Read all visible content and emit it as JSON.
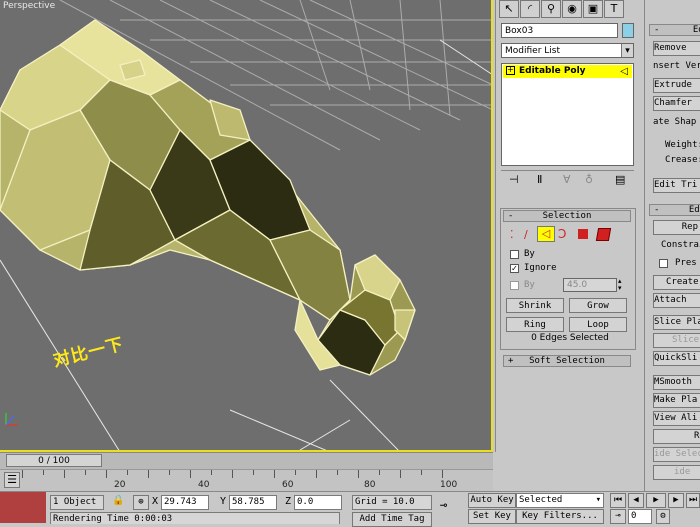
{
  "viewport": {
    "label": "Perspective",
    "caption": "对比一下"
  },
  "timeline": {
    "thumb": "0 / 100",
    "ticks": [
      "20",
      "40",
      "60",
      "80",
      "100"
    ]
  },
  "status": {
    "selection": "1 Object",
    "x_label": "X",
    "x_value": "29.743",
    "y_label": "Y",
    "y_value": "58.785",
    "z_label": "Z",
    "z_value": "0.0",
    "grid": "Grid = 10.0",
    "auto_key": "Auto Key",
    "set_key": "Set Key",
    "selected_dropdown": "Selected",
    "key_filters": "Key Filters...",
    "frame": "0",
    "rendering_time": "Rendering Time  0:00:03",
    "add_time_tag": "Add Time Tag"
  },
  "command_panel": {
    "object_name": "Box03",
    "modifier_list": "Modifier List",
    "stack_item": "Editable Poly",
    "selection_rollout": "Selection",
    "by_vertex_label": "By",
    "ignore_label": "Ignore",
    "by_angle_label": "By",
    "angle_value": "45.0",
    "shrink": "Shrink",
    "grow": "Grow",
    "ring": "Ring",
    "loop": "Loop",
    "selected_info": "0 Edges Selected",
    "soft_selection": "Soft Selection",
    "accent_color": "#ffff00"
  },
  "right_strip": {
    "edit_edges_header": "Edit",
    "remove": "Remove",
    "insert_vertex": "nsert Vert",
    "extrude": "Extrude",
    "chamfer": "Chamfer",
    "create_shape": "ate Shap",
    "weight": "Weight:",
    "crease": "Crease:",
    "edit_tri": "Edit Tri",
    "edit_geometry_header": "Edit",
    "repeat": "Rep",
    "constraints": "Constrain",
    "preserve": "Pres",
    "create": "Create",
    "attach": "Attach",
    "slice_plane": "Slice Pla",
    "slice": "Slice",
    "quickslice": "QuickSli",
    "msmooth": "MSmooth",
    "make_planar": "Make Pla",
    "view_align": "View Ali",
    "re": "Re",
    "hide_selected": "ide Selec",
    "hide": "ide"
  }
}
